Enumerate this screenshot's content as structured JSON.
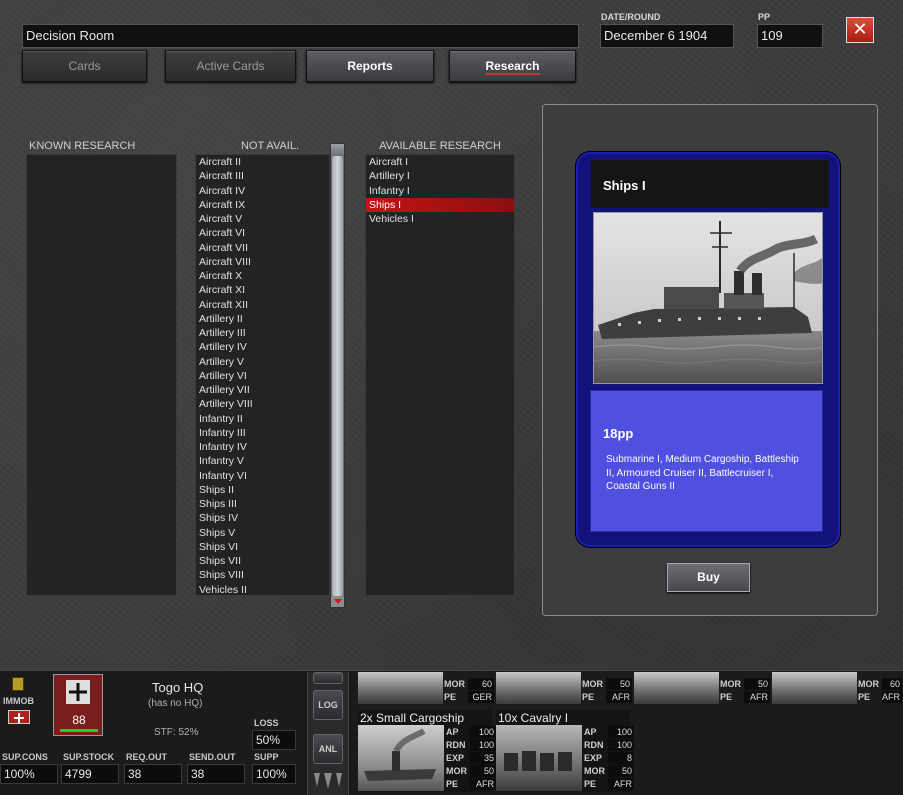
{
  "window": {
    "title": "Decision Room",
    "close_glyph": "✕"
  },
  "header": {
    "date_label": "DATE/ROUND",
    "date_value": "December 6 1904",
    "pp_label": "PP",
    "pp_value": "109"
  },
  "tabs": [
    {
      "label": "Cards",
      "state": "dim"
    },
    {
      "label": "Active Cards",
      "state": "dim"
    },
    {
      "label": "Reports",
      "state": "lit"
    },
    {
      "label": "Research",
      "state": "active"
    }
  ],
  "columns": {
    "known_label": "KNOWN RESEARCH",
    "not_avail_label": "NOT AVAIL.",
    "available_label": "AVAILABLE RESEARCH"
  },
  "known_research": [],
  "not_available": [
    "Aircraft II",
    "Aircraft III",
    "Aircraft IV",
    "Aircraft IX",
    "Aircraft V",
    "Aircraft VI",
    "Aircraft VII",
    "Aircraft VIII",
    "Aircraft X",
    "Aircraft XI",
    "Aircraft XII",
    "Artillery II",
    "Artillery III",
    "Artillery IV",
    "Artillery V",
    "Artillery VI",
    "Artillery VII",
    "Artillery VIII",
    "Infantry II",
    "Infantry III",
    "Infantry IV",
    "Infantry V",
    "Infantry VI",
    "Ships II",
    "Ships III",
    "Ships IV",
    "Ships V",
    "Ships VI",
    "Ships VII",
    "Ships VIII",
    "Vehicles II"
  ],
  "available_research": [
    "Aircraft I",
    "Artillery I",
    "Infantry I",
    "Ships I",
    "Vehicles I"
  ],
  "selected_research": "Ships I",
  "card": {
    "title": "Ships I",
    "cost": "18pp",
    "description": "Submarine I, Medium Cargoship, Battleship II, Armoured Cruiser II, Battlecruiser I, Coastal Guns II",
    "buy_label": "Buy"
  },
  "hud": {
    "immob_label": "IMMOB",
    "unit_strength": "88",
    "hq_name": "Togo HQ",
    "hq_sub": "(has no HQ)",
    "stf": "STF: 52%",
    "loss_label": "LOSS",
    "loss_value": "50%",
    "supp_label": "SUPP",
    "supp_value": "100%",
    "sup_cons_label": "SUP.CONS",
    "sup_cons_value": "100%",
    "sup_stock_label": "SUP.STOCK",
    "sup_stock_value": "4799",
    "req_out_label": "REQ.OUT",
    "req_out_value": "38",
    "send_out_label": "SEND.OUT",
    "send_out_value": "38",
    "log_label": "LOG",
    "anl_label": "ANL",
    "units_top": [
      {
        "mor": "60",
        "pe": "GER"
      },
      {
        "mor": "50",
        "pe": "AFR"
      },
      {
        "mor": "50",
        "pe": "AFR"
      },
      {
        "mor": "60",
        "pe": "AFR"
      }
    ],
    "units_bottom": [
      {
        "title": "2x Small Cargoship",
        "ap": "100",
        "rdn": "100",
        "exp": "35",
        "mor": "50",
        "pe": "AFR"
      },
      {
        "title": "10x Cavalry I",
        "ap": "100",
        "rdn": "100",
        "exp": "8",
        "mor": "50",
        "pe": "AFR"
      }
    ]
  },
  "colors": {
    "selection": "#c41414",
    "card_body": "#4f4fe0",
    "card_frame": "#12127a",
    "close": "#c52a1c"
  }
}
